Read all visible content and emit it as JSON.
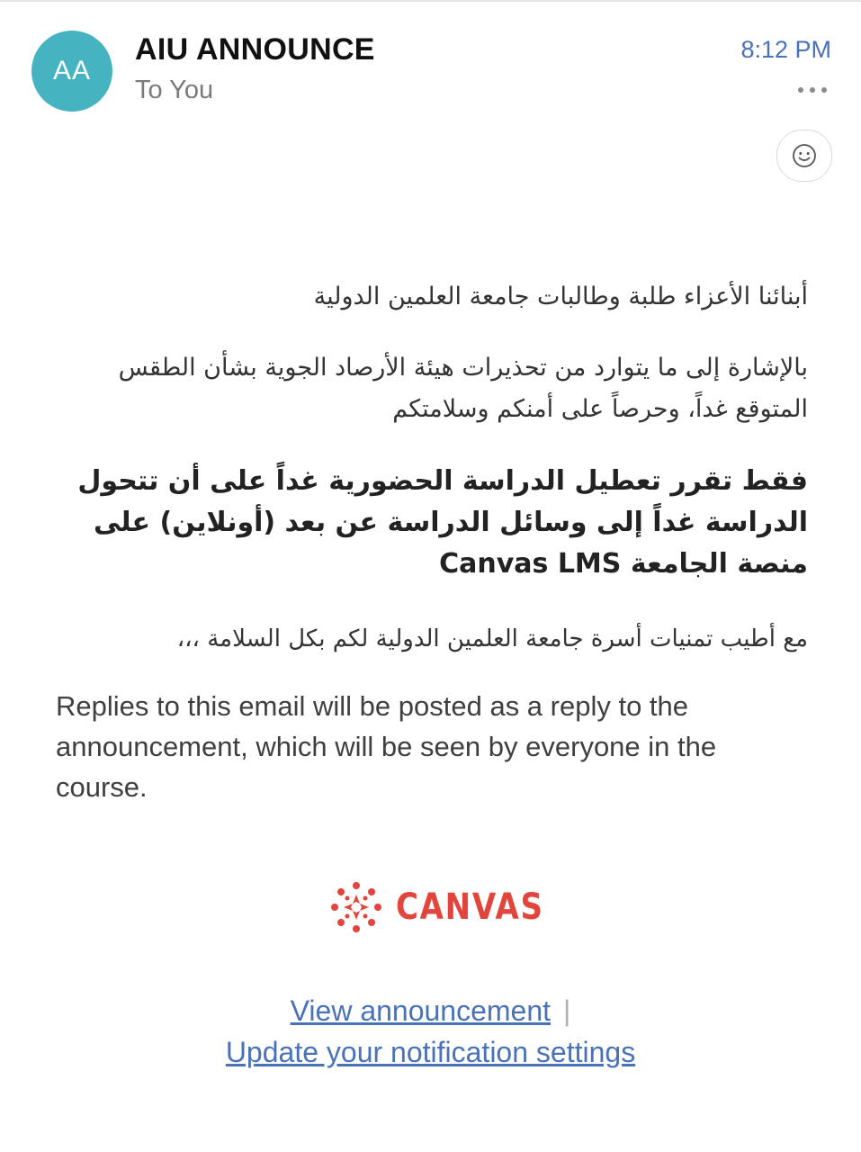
{
  "email": {
    "avatar_initials": "AA",
    "sender": "AIU ANNOUNCE",
    "recipient": "To You",
    "time": "8:12 PM",
    "more_icon": "ellipsis-icon",
    "reaction_icon": "smiley-icon"
  },
  "message": {
    "greeting": "أبنائنا الأعزاء طلبة وطالبات جامعة العلمين الدولية",
    "paragraph1": "بالإشارة إلى ما يتوارد من تحذيرات هيئة الأرصاد الجوية بشأن الطقس المتوقع غداً، وحرصاً على أمنكم وسلامتكم",
    "paragraph2_bold": "فقط تقرر تعطيل الدراسة الحضورية غداً على أن تتحول الدراسة غداً إلى وسائل الدراسة عن بعد (أونلاين) على منصة الجامعة Canvas LMS",
    "closing": "مع أطيب تمنيات أسرة جامعة العلمين الدولية لكم بكل السلامة ،،،",
    "reply_note": "Replies to this email will be posted as a reply to the announcement, which will be seen by everyone in the course."
  },
  "brand": {
    "logo_text": "CANVAS",
    "logo_icon": "canvas-logo-icon",
    "color": "#e2453c"
  },
  "footer": {
    "view_link": "View announcement",
    "separator": "|",
    "settings_link": "Update your notification settings"
  },
  "colors": {
    "avatar": "#45b4c0",
    "link": "#4a72b8",
    "time": "#4a72b8"
  }
}
